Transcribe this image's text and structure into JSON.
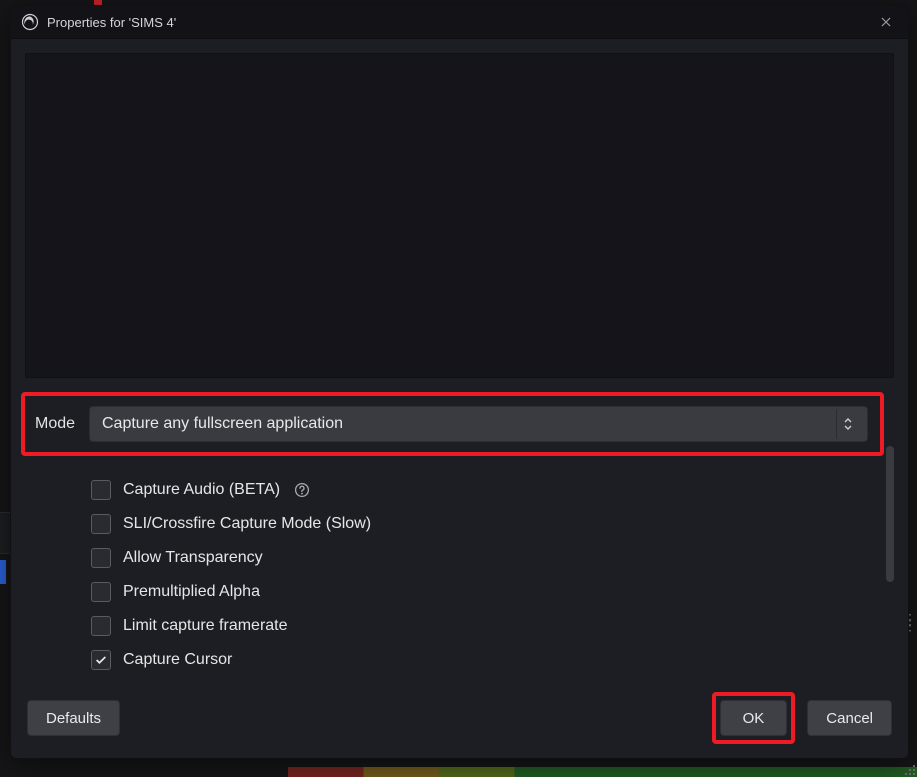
{
  "titlebar": {
    "title": "Properties for 'SIMS 4'"
  },
  "mode": {
    "label": "Mode",
    "value": "Capture any fullscreen application"
  },
  "options": {
    "capture_audio": {
      "label": "Capture Audio (BETA)",
      "checked": false,
      "help": true
    },
    "sli_crossfire": {
      "label": "SLI/Crossfire Capture Mode (Slow)",
      "checked": false
    },
    "allow_trans": {
      "label": "Allow Transparency",
      "checked": false
    },
    "premul_alpha": {
      "label": "Premultiplied Alpha",
      "checked": false
    },
    "limit_fps": {
      "label": "Limit capture framerate",
      "checked": false
    },
    "capture_cursor": {
      "label": "Capture Cursor",
      "checked": true
    }
  },
  "buttons": {
    "defaults": "Defaults",
    "ok": "OK",
    "cancel": "Cancel"
  },
  "colors": {
    "highlight": "#ed1c24"
  }
}
